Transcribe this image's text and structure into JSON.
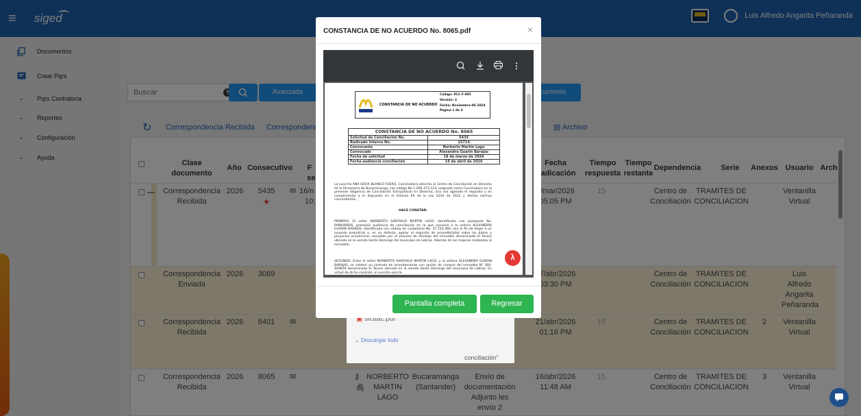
{
  "app": {
    "logo": "siged",
    "user_name": "Luis Alfredo Angarita Peñaranda"
  },
  "sidebar": {
    "items": [
      {
        "label": "Documentos",
        "icon": "documents-icon"
      },
      {
        "label": "Crear Pqrs",
        "icon": "chat-icon"
      },
      {
        "label": "Pqrs Contraloria",
        "icon": "chevron-down-icon"
      },
      {
        "label": "Reportes",
        "icon": "chevron-down-icon"
      },
      {
        "label": "Configuración",
        "icon": "chevron-down-icon"
      },
      {
        "label": "Ayuda",
        "icon": "chevron-down-icon"
      }
    ]
  },
  "toolbar": {
    "search_placeholder": "Buscar",
    "advanced_label": "Avanzada",
    "new_doc_label": "cumento",
    "help_icon": "?"
  },
  "tabs": [
    {
      "label": "Correspondencia Recibida"
    },
    {
      "label": "Correspondenc"
    }
  ],
  "archivo_label": "Archivo",
  "table": {
    "headers": {
      "clase": "Clase documento",
      "anio": "Año",
      "consecutivo": "Consecutivo",
      "f": "F",
      "segu": "segu",
      "fecha_rad": "Fecha Radicación",
      "tiempo_resp": "Tiempo respuesta",
      "tiempo_rest": "Tiempo restante",
      "dependencia": "Dependencia",
      "serie": "Serie",
      "anexos": "Anexos",
      "usuario": "Usuario",
      "arch": "Arch"
    },
    "rows": [
      {
        "clase": "Correspondencia Recibida",
        "anio": "2026",
        "consecutivo": "5435",
        "f1": "16/n",
        "f2": "10:",
        "fecha": "3/mar/2026",
        "hora": "05:05 PM",
        "tiempo_resp": "15",
        "dependencia": "Centro de Conciliación",
        "serie": "TRAMITES DE CONCILIACION",
        "anexos": "",
        "usuario": "Ventanilla Virtual"
      },
      {
        "clase": "Correspondencia Enviada",
        "anio": "2026",
        "consecutivo": "3089",
        "fecha": "27/abr/2026",
        "hora": "03:30 PM",
        "tiempo_resp": "",
        "dependencia": "Centro de Conciliación",
        "serie": "TRAMITES DE CONCILIACION",
        "anexos": "",
        "usuario": "Luis Alfredo Angarita Peñaranda"
      },
      {
        "clase": "Correspondencia Recibida",
        "anio": "2026",
        "consecutivo": "8401",
        "fecha": "21/abr/2026",
        "hora": "01:16 PM",
        "tiempo_resp": "15",
        "dependencia": "Centro de Conciliación",
        "serie": "TRAMITES DE CONCILIACION",
        "anexos": "2",
        "usuario": "Ventanilla Virtual"
      },
      {
        "clase": "Correspondencia Recibida",
        "anio": "2026",
        "consecutivo": "8065",
        "remitente": "NORBERTO MARTIN LAGO",
        "ciudad": "Bucaramanga (Santander)",
        "asunto": "Envío de documentación Adjunto les envío 2",
        "fecha": "16/abr/2026",
        "hora": "11:48 AM",
        "tiempo_resp": "15",
        "dependencia": "Centro de Conciliación",
        "serie": "TRAMITES DE CONCILIACION",
        "anexos": "3",
        "usuario": "Ventanilla Virtual"
      }
    ]
  },
  "popup": {
    "file": "sicaac.pdf",
    "download_all": "Descargar todo",
    "text": "conciliación\""
  },
  "modal": {
    "title": "CONSTANCIA DE NO ACUERDO No. 8065.pdf",
    "close": "×",
    "fullscreen_label": "Pantalla completa",
    "back_label": "Regresar"
  },
  "pdf": {
    "header_title": "CONSTANCIA DE NO ACUERDO",
    "codigo": "Código: PCC-F-005",
    "version": "Versión: 3",
    "fecha": "Fecha: Noviembre-06-2024",
    "pagina": "Página 1 de 3",
    "logo_text": "PERSONERIA",
    "doc_title": "CONSTANCIA DE NO ACUERDO No. 8065",
    "rows": [
      {
        "k": "Solicitud de Conciliación No.",
        "v": "5435"
      },
      {
        "k": "Radicado Interno No.",
        "v": "15714"
      },
      {
        "k": "Convocante",
        "v": "Norberto Martin Lago"
      },
      {
        "k": "Convocado",
        "v": "Alexandra Guarin Barajas"
      },
      {
        "k": "Fecha de solicitud",
        "v": "18 de marzo de 2026"
      },
      {
        "k": "Fecha audiencia conciliación",
        "v": "16 de abril de 2026"
      }
    ],
    "intro": "La suscrita ANA SOFIA BLANCO FOERO, Conciliadora adscrita al Centro de Conciliación en Derecho de la Personería de Bucaramanga, con código No 1.005.373.123, asignada como Conciliadora en la presente diligencia de Conciliación Extrajudicial en Derecho, una vez agotado el requisito y en cumplimiento a lo dispuesto en el Artículo 65 de la Ley 2220 de 2022 y demás normas concordantes,",
    "hace_constar": "HACE CONSTAR:",
    "primero": "PRIMERO: El señor NORBERTO SANTIAGO MARTIN LAGO, identificado con pasaporte No. PAM649856, promovió audiencia de conciliación en la que convocó a la señora ALEXANDRA GUARIN BARAJAS, identificada con cédula de ciudadanía No. 37.720.360, con el fin de llegar a un acuerdo prejudicial o, en su defecto, agotar el requisito de procedibilidad sobre los daños y perjuicios económicos causados por el proceso de desalojo del inmueble denominado El Tesoro ubicado en la vereda Santo Domingo del municipio de Lebrija. Además de las mejoras realizadas al inmueble.",
    "segundo": "SEGUNDO: Entre el señor NORBERTO SANTIAGO MARTIN LAGO, y la señora ALEXANDRA GUARIN BARAJAS, se celebró un contrato de arrendamiento con opción de compra del inmueble N° 300-449659 denominado El Tesoro ubicado en la vereda Santo Domingo del municipio de Lebrija. En virtud de dicho contrato, el suscrito ejercía"
  },
  "colors": {
    "primary": "#1e63b0",
    "button": "#2196f3",
    "green": "#2eb451",
    "pdf_red": "#e53935"
  }
}
